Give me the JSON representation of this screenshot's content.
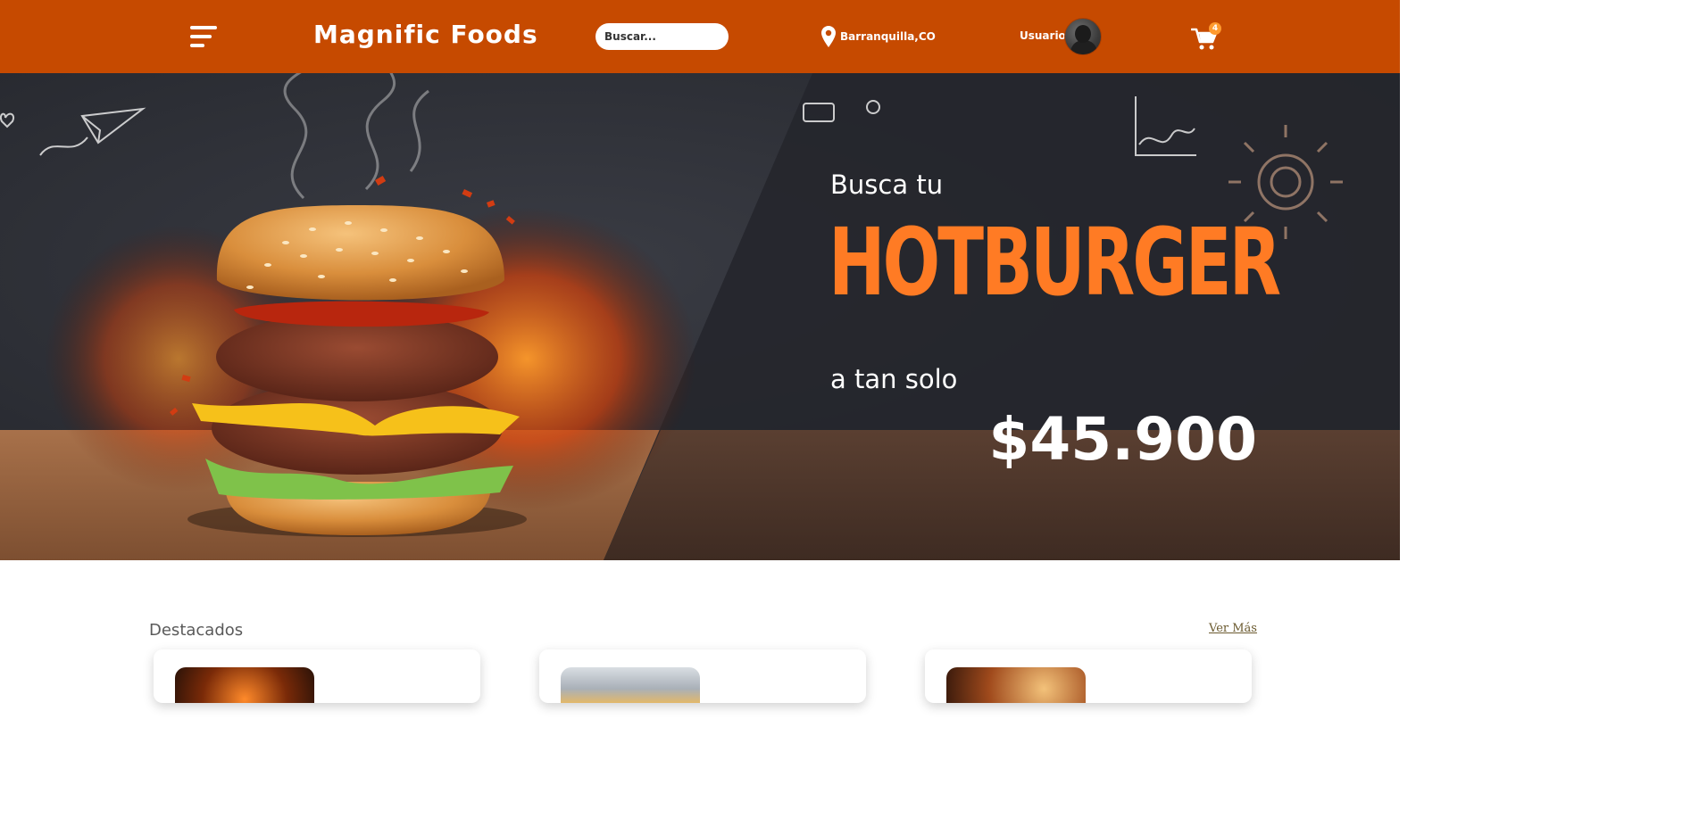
{
  "header": {
    "brand": "Magnific Foods",
    "search_placeholder": "Buscar...",
    "location": "Barranquilla,CO",
    "user_label": "Usuario",
    "cart_count": "4",
    "menu_icon": "hamburger-menu-icon",
    "location_icon": "map-pin-icon",
    "cart_icon": "shopping-cart-icon",
    "bg_color": "#c64a00"
  },
  "hero": {
    "intro": "Busca tu",
    "title": "HOTBURGER",
    "middle": "a tan solo",
    "price": "$45.900",
    "title_color": "#ff7b24"
  },
  "featured": {
    "title": "Destacados",
    "more_link": "Ver Más"
  }
}
